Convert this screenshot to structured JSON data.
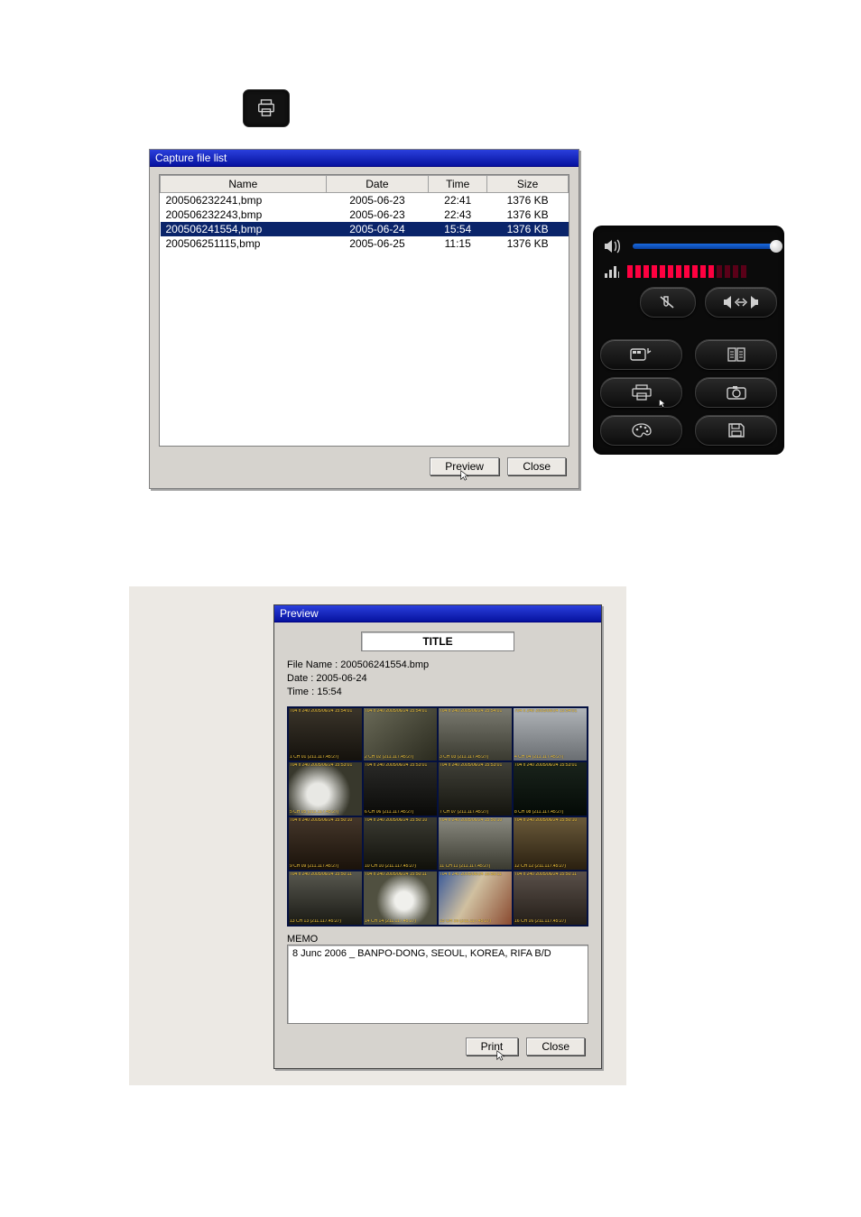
{
  "top_icon": {
    "name": "print-page-icon"
  },
  "capture": {
    "title": "Capture file list",
    "columns": [
      "Name",
      "Date",
      "Time",
      "Size"
    ],
    "rows": [
      {
        "name": "200506232241,bmp",
        "date": "2005-06-23",
        "time": "22:41",
        "size": "1376 KB",
        "selected": false
      },
      {
        "name": "200506232243,bmp",
        "date": "2005-06-23",
        "time": "22:43",
        "size": "1376 KB",
        "selected": false
      },
      {
        "name": "200506241554,bmp",
        "date": "2005-06-24",
        "time": "15:54",
        "size": "1376 KB",
        "selected": true
      },
      {
        "name": "200506251115,bmp",
        "date": "2005-06-25",
        "time": "11:15",
        "size": "1376 KB",
        "selected": false
      }
    ],
    "preview_label": "Preview",
    "close_label": "Close"
  },
  "panel": {
    "volume_icon": "speaker-icon",
    "volume_value": 100,
    "level_icon": "level-bars-icon",
    "mic_mute_icon": "mic-mute-icon",
    "talk_toggle_icon": "two-way-talk-icon",
    "buttons": [
      {
        "name": "osd-config-button",
        "icon": "osd-icon"
      },
      {
        "name": "log-button",
        "icon": "log-icon"
      },
      {
        "name": "print-button",
        "icon": "printer-icon"
      },
      {
        "name": "snapshot-button",
        "icon": "camera-icon"
      },
      {
        "name": "color-button",
        "icon": "palette-icon"
      },
      {
        "name": "save-button",
        "icon": "floppy-icon"
      }
    ]
  },
  "preview": {
    "title": "Preview",
    "title_input_value": "TITLE",
    "file_name_label": "File Name : 200506241554.bmp",
    "date_label": "Date : 2005-06-24",
    "time_label": "Time : 15:54",
    "memo_label": "MEMO",
    "memo_value": "8 Junc 2006 _ BANPO-DONG, SEOUL, KOREA, RIFA B/D",
    "print_label": "Print",
    "close_label": "Close",
    "thumbs": [
      {
        "top": "704 x 240 2005/06/24 15:54:01",
        "bot": "1 CH 01 (211.117.45:27)",
        "bg": "linear-gradient(#3a342a,#14110c)"
      },
      {
        "top": "704 x 240 2005/06/24 15:54:01",
        "bot": "2 CH 02 (211.117.45:27)",
        "bg": "linear-gradient(140deg,#6a6a58,#2a2a1e)"
      },
      {
        "top": "704 x 240 2005/06/24 15:54:01",
        "bot": "3 CH 03 (211.117.45:27)",
        "bg": "linear-gradient(#7a7a70,#3a3a30)"
      },
      {
        "top": "704 x 240 2005/06/24 15:54:01",
        "bot": "4 CH 04 (211.117.45:27)",
        "bg": "linear-gradient(#b0b4b8,#6a6e72)"
      },
      {
        "top": "704 x 240 2005/06/24 15:53:01",
        "bot": "5 CH 05 (211.117.45:27)",
        "bg": "radial-gradient(circle at 40% 60%,#e8e8e4 20%,#38382c 60%)"
      },
      {
        "top": "704 x 240 2005/06/24 15:53:01",
        "bot": "6 CH 06 (211.117.45:27)",
        "bg": "linear-gradient(#2a2a28,#0a0a08)"
      },
      {
        "top": "704 x 240 2005/06/24 15:53:01",
        "bot": "7 CH 07 (211.117.45:27)",
        "bg": "linear-gradient(#404038,#14140e)"
      },
      {
        "top": "704 x 240 2005/06/24 15:53:01",
        "bot": "8 CH 08 (211.117.45:27)",
        "bg": "linear-gradient(#1a241c,#040a06)"
      },
      {
        "top": "704 x 240 2005/06/24 15:50:10",
        "bot": "9 CH 09 (211.117.45:27)",
        "bg": "linear-gradient(#44362a,#1a120a)"
      },
      {
        "top": "704 x 240 2005/06/24 15:50:10",
        "bot": "10 CH 10 (211.117.45:27)",
        "bg": "linear-gradient(#3a3a32,#10100a)"
      },
      {
        "top": "704 x 240 2005/06/24 15:50:10",
        "bot": "11 CH 11 (211.117.45:27)",
        "bg": "linear-gradient(#8a8a80,#3a3a30)"
      },
      {
        "top": "704 x 240 2005/06/24 15:50:10",
        "bot": "12 CH 12 (211.117.45:27)",
        "bg": "linear-gradient(#6a5a3a,#2a2010)"
      },
      {
        "top": "704 x 240 2005/06/24 15:50:11",
        "bot": "13 CH 13 (211.117.45:27)",
        "bg": "linear-gradient(#585850,#1a1a14)"
      },
      {
        "top": "704 x 240 2005/06/24 15:50:11",
        "bot": "14 CH 14 (211.117.45:27)",
        "bg": "radial-gradient(circle at 55% 55%,#f0f0ec 18%,#505040 55%)"
      },
      {
        "top": "704 x 240 2005/06/24 15:50:11",
        "bot": "15 CH 15 (211.117.45:27)",
        "bg": "linear-gradient(120deg,#3a5a9a,#d0c0a0 45%,#8a4a30)"
      },
      {
        "top": "704 x 240 2005/06/24 15:50:11",
        "bot": "16 CH 16 (211.117.45:27)",
        "bg": "linear-gradient(#5a504a,#241e18)"
      }
    ]
  }
}
